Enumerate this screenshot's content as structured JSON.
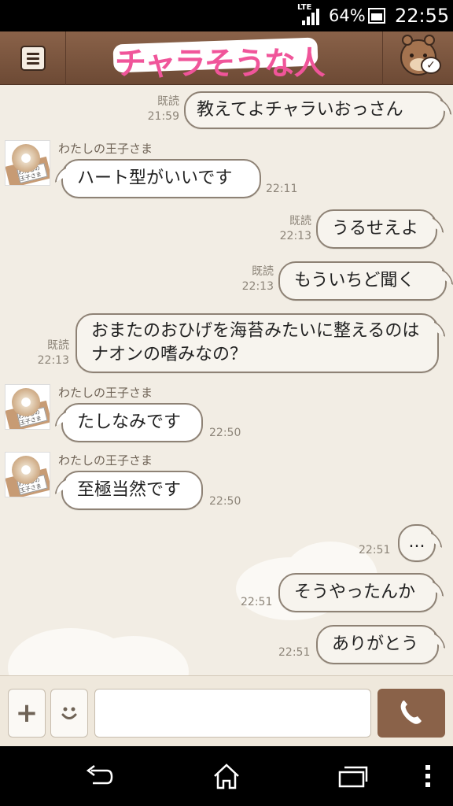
{
  "status_bar": {
    "network": "LTE",
    "battery": "64%",
    "battery_level": 0.64,
    "time": "22:55"
  },
  "header": {
    "title": "チャラそうな人",
    "menu_icon": "menu-icon",
    "character_icon": "brown-bear-icon"
  },
  "messages": [
    {
      "side": "out",
      "text": "教えてよチャラいおっさん",
      "read": "既読",
      "time": "21:59"
    },
    {
      "side": "in",
      "sender": "わたしの王子さま",
      "text": "ハート型がいいです",
      "time": "22:11"
    },
    {
      "side": "out",
      "text": "うるせえよ",
      "read": "既読",
      "time": "22:13"
    },
    {
      "side": "out",
      "text": "もういちど聞く",
      "read": "既読",
      "time": "22:13"
    },
    {
      "side": "out",
      "text": "おまたのおひげを海苔みたいに整えるのはナオンの嗜みなの？",
      "read": "既読",
      "time": "22:13"
    },
    {
      "side": "in",
      "sender": "わたしの王子さま",
      "text": "たしなみです",
      "time": "22:50"
    },
    {
      "side": "in",
      "sender": "わたしの王子さま",
      "text": "至極当然です",
      "time": "22:50"
    },
    {
      "side": "out",
      "text": "...",
      "time": "22:51"
    },
    {
      "side": "out",
      "text": "そうやったんか",
      "time": "22:51"
    },
    {
      "side": "out",
      "text": "ありがとう",
      "time": "22:51"
    }
  ],
  "avatar_label": "わたしの王子さま",
  "input": {
    "placeholder": "",
    "add_icon": "plus-icon",
    "sticker_icon": "smiley-icon",
    "call_icon": "phone-icon"
  },
  "nav": {
    "back_icon": "back-icon",
    "home_icon": "home-icon",
    "recents_icon": "recent-apps-icon",
    "menu_icon": "overflow-menu-icon"
  }
}
